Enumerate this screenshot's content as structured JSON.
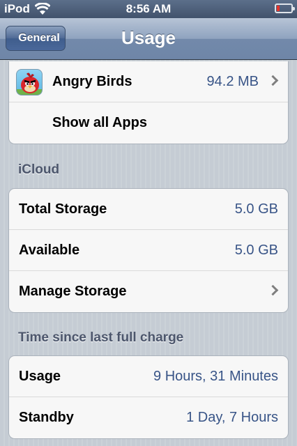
{
  "statusbar": {
    "carrier": "iPod",
    "time": "8:56 AM",
    "battery_level": 0.1,
    "battery_color": "#e4342c"
  },
  "navbar": {
    "title": "Usage",
    "back_label": "General"
  },
  "apps": {
    "rows": [
      {
        "label": "Angry Birds",
        "value": "94.2 MB",
        "icon": "angry-birds-app-icon"
      }
    ],
    "show_all_label": "Show all Apps"
  },
  "icloud": {
    "header": "iCloud",
    "total_label": "Total Storage",
    "total_value": "5.0 GB",
    "available_label": "Available",
    "available_value": "5.0 GB",
    "manage_label": "Manage Storage"
  },
  "charge": {
    "header": "Time since last full charge",
    "usage_label": "Usage",
    "usage_value": "9 Hours, 31 Minutes",
    "standby_label": "Standby",
    "standby_value": "1 Day, 7 Hours"
  },
  "colors": {
    "value_text": "#385487",
    "background": "#c5ccd4"
  }
}
